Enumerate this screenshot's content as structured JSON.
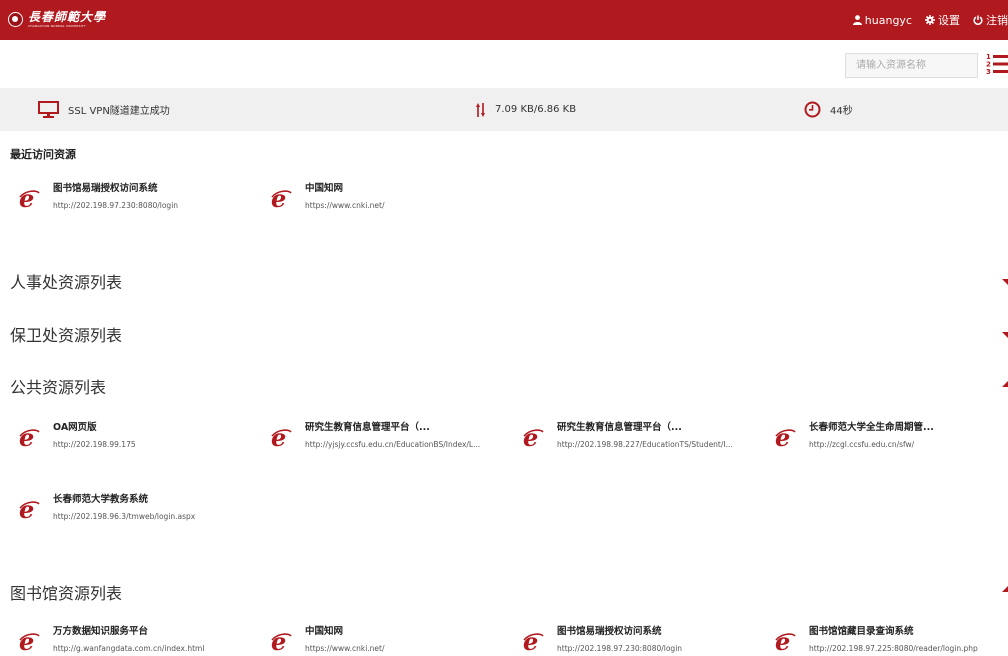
{
  "header": {
    "logo_cn": "長春師範大學",
    "logo_en": "CHANGCHUN NORMAL UNIVERSITY",
    "username": "huangyc",
    "settings_label": "设置",
    "logout_label": "注销",
    "brand_color": "#b0191e"
  },
  "search": {
    "placeholder": "请输入资源名称"
  },
  "status": {
    "vpn_text": "SSL VPN隧道建立成功",
    "traffic_text": "7.09 KB/6.86 KB",
    "time_text": "44秒"
  },
  "recent": {
    "title": "最近访问资源",
    "items": [
      {
        "name": "图书馆易瑞授权访问系统",
        "url": "http://202.198.97.230:8080/login"
      },
      {
        "name": "中国知网",
        "url": "https://www.cnki.net/"
      }
    ]
  },
  "sections": [
    {
      "title": "人事处资源列表",
      "expanded": false,
      "items": []
    },
    {
      "title": "保卫处资源列表",
      "expanded": false,
      "items": []
    },
    {
      "title": "公共资源列表",
      "expanded": true,
      "items": [
        {
          "name": "OA网页版",
          "url": "http://202.198.99.175"
        },
        {
          "name": "研究生教育信息管理平台（...",
          "url": "http://yjsjy.ccsfu.edu.cn/EducationBS/Index/L..."
        },
        {
          "name": "研究生教育信息管理平台（...",
          "url": "http://202.198.98.227/EducationTS/Student/I..."
        },
        {
          "name": "长春师范大学全生命周期管...",
          "url": "http://zcgl.ccsfu.edu.cn/sfw/"
        },
        {
          "name": "长春师范大学教务系统",
          "url": "http://202.198.96.3/tmweb/login.aspx"
        }
      ]
    },
    {
      "title": "图书馆资源列表",
      "expanded": true,
      "items": [
        {
          "name": "万方数据知识服务平台",
          "url": "http://g.wanfangdata.com.cn/index.html"
        },
        {
          "name": "中国知网",
          "url": "https://www.cnki.net/"
        },
        {
          "name": "图书馆易瑞授权访问系统",
          "url": "http://202.198.97.230:8080/login"
        },
        {
          "name": "图书馆馆藏目录查询系统",
          "url": "http://202.198.97.225:8080/reader/login.php"
        }
      ]
    }
  ],
  "icons": {
    "resource": "ie-icon",
    "vpn": "monitor-icon",
    "traffic": "up-down-arrows-icon",
    "time": "clock-icon",
    "user": "user-icon",
    "settings": "gear-icon",
    "logout": "power-icon",
    "list_toggle": "ordered-list-icon"
  }
}
